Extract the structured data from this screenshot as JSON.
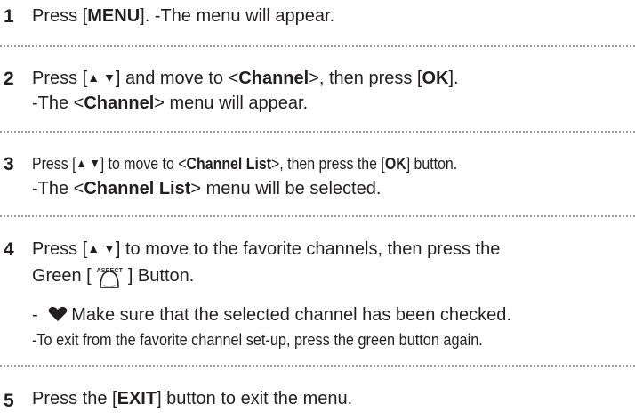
{
  "steps": [
    {
      "number": "1"
    },
    {
      "number": "2"
    },
    {
      "number": "3"
    },
    {
      "number": "4"
    },
    {
      "number": "5"
    }
  ],
  "s1": {
    "a": "Press [",
    "b": "MENU",
    "c": "]. -The menu will appear."
  },
  "s2": {
    "a": "Press [",
    "arrows": "▲ ▼",
    "b": "] and move to <",
    "c": "Channel",
    "d": ">, then press [",
    "e": "OK",
    "f": "].",
    "g": "-The <",
    "h": "Channel",
    "i": "> menu will appear."
  },
  "s3": {
    "a": "Press [",
    "arrows": "▲ ▼",
    "b": "] to move to <",
    "c": "Channel List",
    "d": ">, then press the [",
    "e": "OK",
    "f": "] button.",
    "g": "-The <",
    "h": "Channel List",
    "i": "> menu will be selected."
  },
  "s4": {
    "a": "Press [",
    "arrows": "▲ ▼",
    "b": "] to move to the favorite channels, then press the",
    "c": "Green [ ",
    "icon_label": "ASPECT",
    "d": " ] Button.",
    "e": "- ",
    "f": "Make sure that the selected channel has been checked.",
    "g": "-To exit from the favorite channel set-up, press the green button again."
  },
  "s5": {
    "a": "Press the [",
    "b": "EXIT",
    "c": "] button to exit the menu."
  },
  "icons": {
    "aspect": "aspect-button-icon",
    "favorite": "heart-icon"
  }
}
